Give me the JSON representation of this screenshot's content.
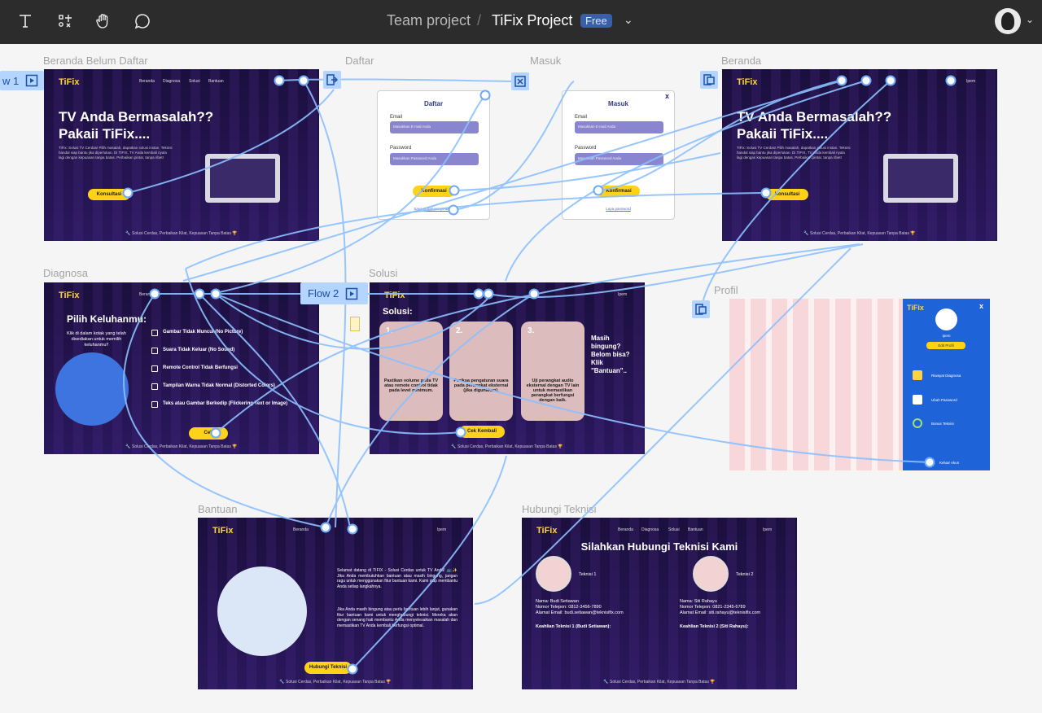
{
  "toolbar": {
    "tools": [
      "text-tool-icon",
      "frame-tool-icon",
      "hand-tool-icon",
      "comment-tool-icon"
    ],
    "team": "Team project",
    "separator": "/",
    "project": "TiFix Project",
    "badge": "Free"
  },
  "frames": {
    "beranda_belum": {
      "label": "Beranda Belum Daftar",
      "logo": "TiFix",
      "nav": [
        "Beranda",
        "Diagnosa",
        "Solusi",
        "Bantuan"
      ],
      "hero1": "TV Anda Bermasalah??",
      "hero2": "Pakaii TiFix....",
      "sub": "TiFix: Solusi TV Cerdas! Pilih masalah, dapatkan solusi instan. Teknisi handal siap bantu jika diperlukan. Di TIFIX, TV Anda kembali nyala lagi dengan kepuasan tanpa batas. Perbaikan pintar, tanpa ribet!",
      "cta": "Konsultasi",
      "footer": "🔧 Solusi Cerdas, Perbaikan Kilat, Kepuasan Tanpa Batas 🏆"
    },
    "daftar": {
      "label": "Daftar",
      "title": "Daftar",
      "email_label": "Email",
      "email_ph": "Masukkan E-mail Anda",
      "pw_label": "Password",
      "pw_ph": "Masukkan Password Anda",
      "btn": "Konfirmasi",
      "link": "Saya sudah punya akun"
    },
    "masuk": {
      "label": "Masuk",
      "title": "Masuk",
      "close": "x",
      "email_label": "Email",
      "email_ph": "Masukkan E-mail Anda",
      "pw_label": "Password",
      "pw_ph": "Masukkan Password Anda",
      "btn": "Konfirmasi",
      "link": "Lupa password"
    },
    "beranda": {
      "label": "Beranda",
      "logo": "TiFix",
      "nav": [
        "Beranda",
        "Diagnosa",
        "Solusi",
        "Bantuan"
      ],
      "user": "Ipem",
      "hero1": "TV Anda Bermasalah??",
      "hero2": "Pakaii TiFix....",
      "sub": "TiFix: Solusi TV Cerdas! Pilih masalah, dapatkan solusi instan. Teknisi handal siap bantu jika diperlukan. Di TIFIX, TV Anda kembali nyala lagi dengan kepuasan tanpa batas. Perbaikan pintar, tanpa ribet!",
      "cta": "Konsultasi",
      "footer": "🔧 Solusi Cerdas, Perbaikan Kilat, Kepuasan Tanpa Batas 🏆"
    },
    "diagnosa": {
      "label": "Diagnosa",
      "logo": "TiFix",
      "nav": [
        "Beranda"
      ],
      "heading": "Pilih Keluhanmu:",
      "hint": "Klik di dalam kotak yang telah disediakan untuk memilih keluhanmu!!",
      "items": [
        "Gambar Tidak Muncul (No Picture)",
        "Suara Tidak Keluar (No Sound)",
        "Remote Control Tidak Berfungsi",
        "Tampilan Warna Tidak Normal (Distorted Colors)",
        "Teks atau Gambar Berkedip (Flickering Text or Image)"
      ],
      "btn": "Cek",
      "footer": "🔧 Solusi Cerdas, Perbaikan Kilat, Kepuasan Tanpa Batas 🏆"
    },
    "solusi": {
      "label": "Solusi",
      "logo": "TiFix",
      "user": "Ipem",
      "heading": "Solusi:",
      "cards": [
        {
          "num": "1.",
          "text": "Pastikan volume pada TV atau remote control tidak pada level minimum."
        },
        {
          "num": "2.",
          "text": "Periksa pengaturan suara pada perangkat eksternal (jika digunakan)."
        },
        {
          "num": "3.",
          "text": "Uji perangkat audio eksternal dengan TV lain untuk memastikan perangkat berfungsi dengan baik."
        }
      ],
      "side": "Masih bingung? Belom bisa? Klik \"Bantuan\"..",
      "btn": "Cek Kembali",
      "footer": "🔧 Solusi Cerdas, Perbaikan Kilat, Kepuasan Tanpa Batas 🏆"
    },
    "profil": {
      "label": "Profil",
      "logo": "TiFix",
      "close": "x",
      "name": "Ipem",
      "edit": "Edit Profil",
      "menu": [
        "Riwayat Diagnosa",
        "Ubah Password",
        "Bonus Teknisi"
      ],
      "logout": "Keluar Akun"
    },
    "bantuan": {
      "label": "Bantuan",
      "logo": "TiFix",
      "nav": [
        "Beranda"
      ],
      "user": "Ipem",
      "p1": "Selamat datang di TIFIX - Solusi Cerdas untuk TV Anda! 📺✨ Jika Anda membutuhkan bantuan atau masih bingung, jangan ragu untuk menggunakan fitur bantuan kami. Kami siap membantu Anda setiap langkahnya.",
      "p2": "Jika Anda masih bingung atau perlu bantuan lebih lanjut, gunakan fitur bantuan kami untuk menghubungi teknisi. Mereka akan dengan senang hati membantu Anda menyelesaikan masalah dan memastikan TV Anda kembali berfungsi optimal.",
      "btn": "Hubungi Teknisi",
      "footer": "🔧 Solusi Cerdas, Perbaikan Kilat, Kepuasan Tanpa Batas 🏆"
    },
    "hubungi": {
      "label": "Hubungi Teknisi",
      "logo": "TiFix",
      "nav": [
        "Beranda",
        "Diagnosa",
        "Solusi",
        "Bantuan"
      ],
      "user": "Ipem",
      "title": "Silahkan Hubungi Teknisi Kami",
      "t1": "Teknisi 1",
      "t2": "Teknisi 2",
      "c1": [
        "Nama: Budi Setiawan",
        "Nomor Telepon: 0812-3456-7890",
        "Alamat Email: budi.setiawan@teknisifix.com"
      ],
      "c2": [
        "Nama: Siti Rahayu",
        "Nomor Telepon: 0821-2345-6789",
        "Alamat Email: siti.rahayu@teknisifix.com"
      ],
      "k1": "Keahlian Teknisi 1 (Budi Setiawan):",
      "k2": "Keahlian Teknisi 2 (Siti Rahayu):",
      "footer": "🔧 Solusi Cerdas, Perbaikan Kilat, Kepuasan Tanpa Batas 🏆"
    }
  },
  "flows": {
    "flow1": "w 1",
    "flow2": "Flow 2"
  }
}
